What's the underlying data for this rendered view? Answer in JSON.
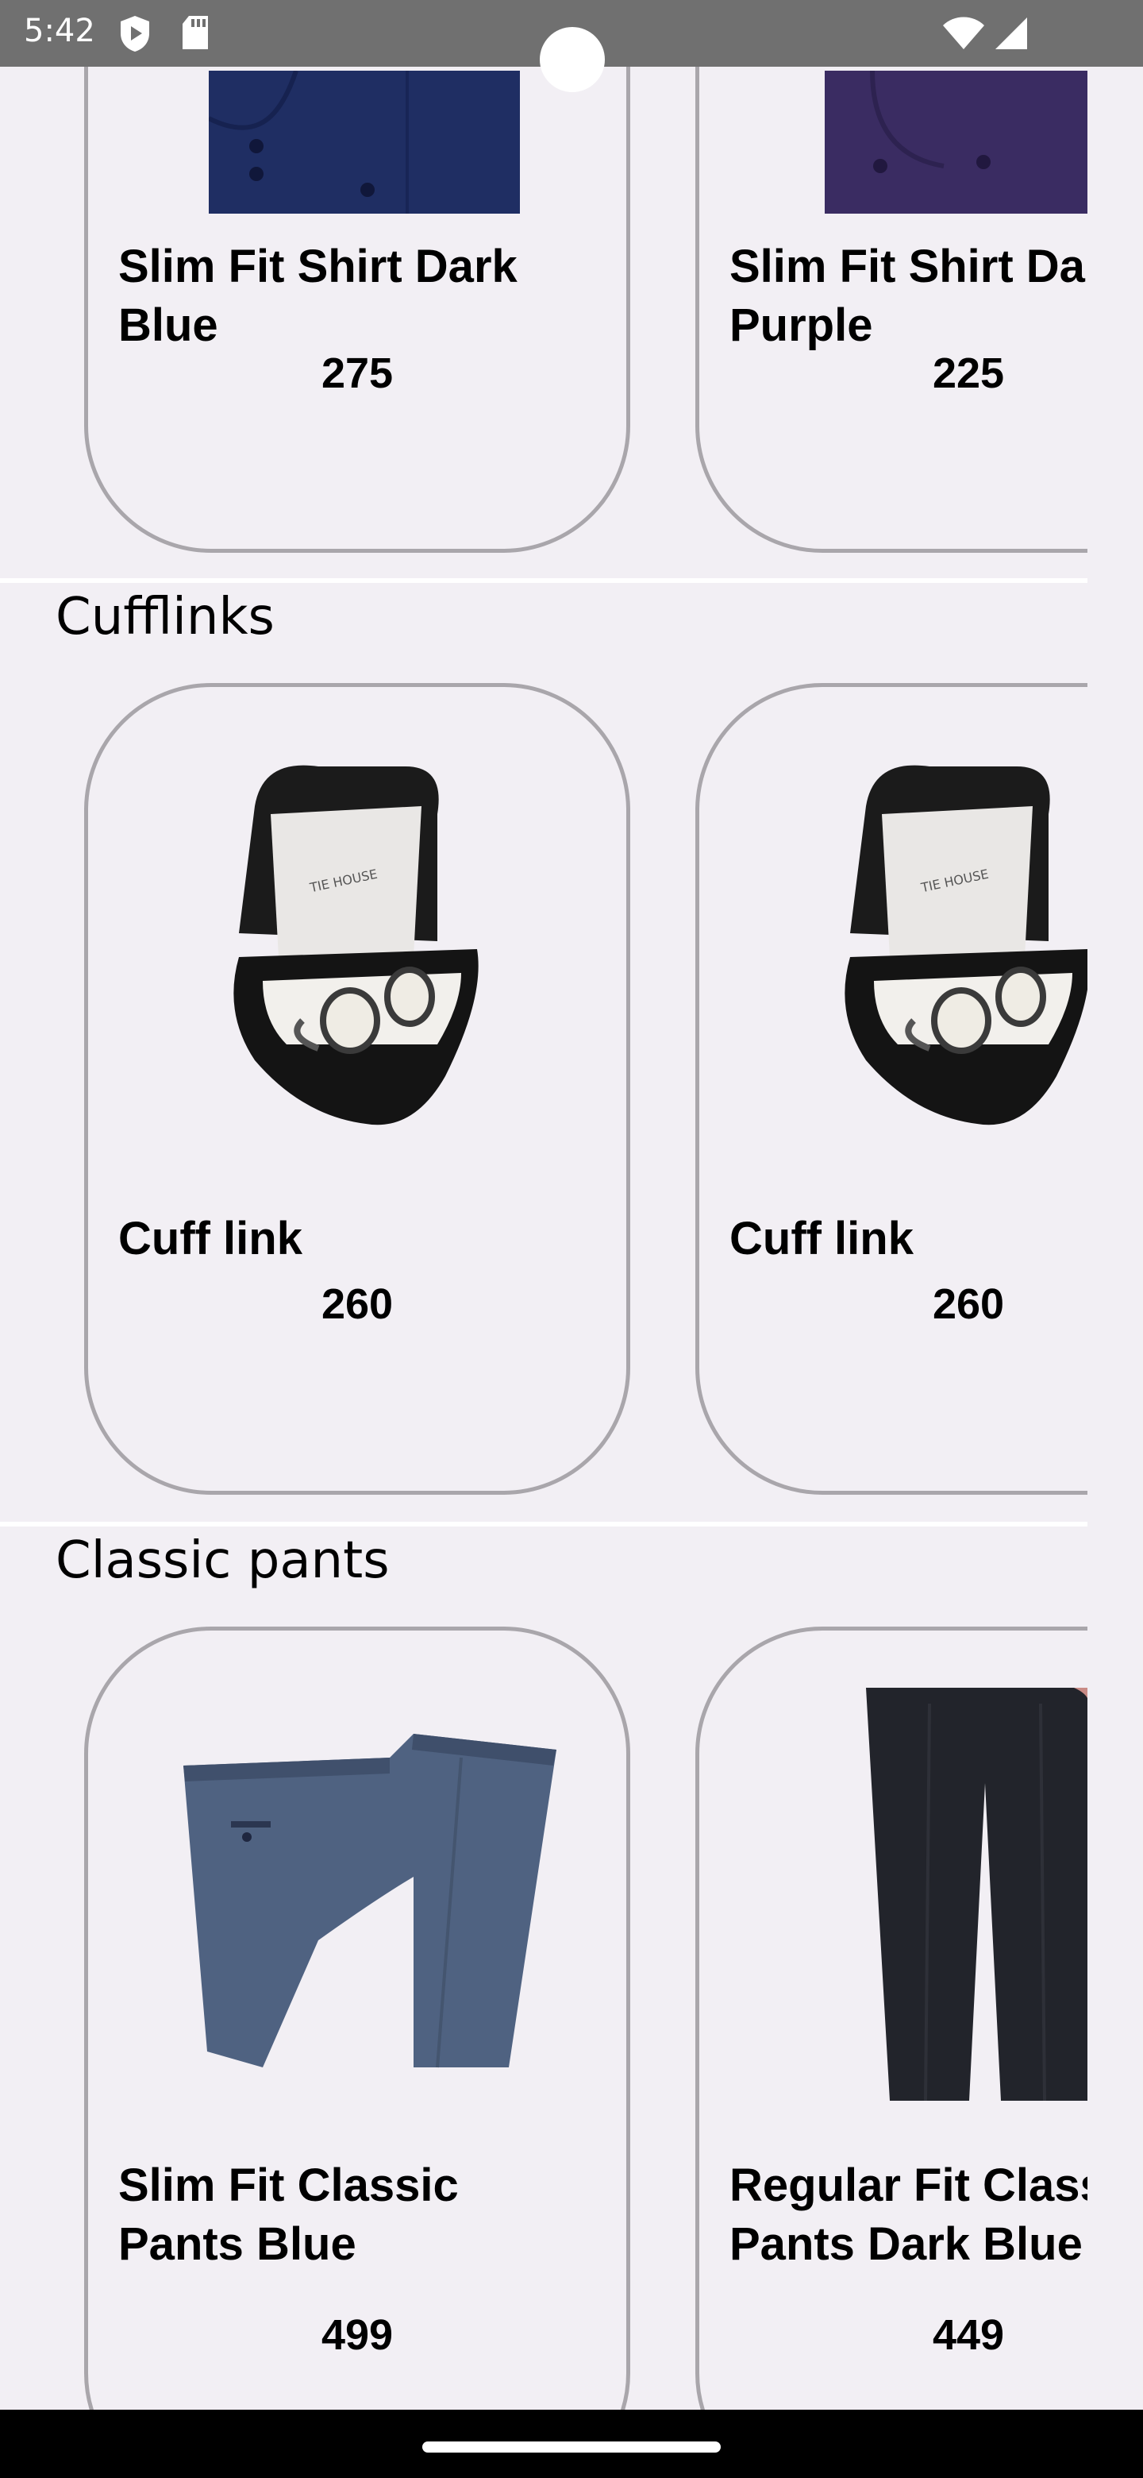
{
  "status": {
    "time": "5:42"
  },
  "sections": [
    {
      "title": "",
      "items": [
        {
          "name": "Slim Fit Shirt Dark Blue",
          "price": "275"
        },
        {
          "name": "Slim Fit Shirt Dark Purple",
          "price": "225"
        }
      ]
    },
    {
      "title": "Cufflinks",
      "items": [
        {
          "name": "Cuff link",
          "price": "260"
        },
        {
          "name": "Cuff link",
          "price": "260"
        }
      ]
    },
    {
      "title": "Classic pants",
      "items": [
        {
          "name": "Slim Fit Classic Pants Blue",
          "price": "499"
        },
        {
          "name": "Regular Fit Classic Pants Dark Blue",
          "price": "449"
        }
      ]
    }
  ]
}
